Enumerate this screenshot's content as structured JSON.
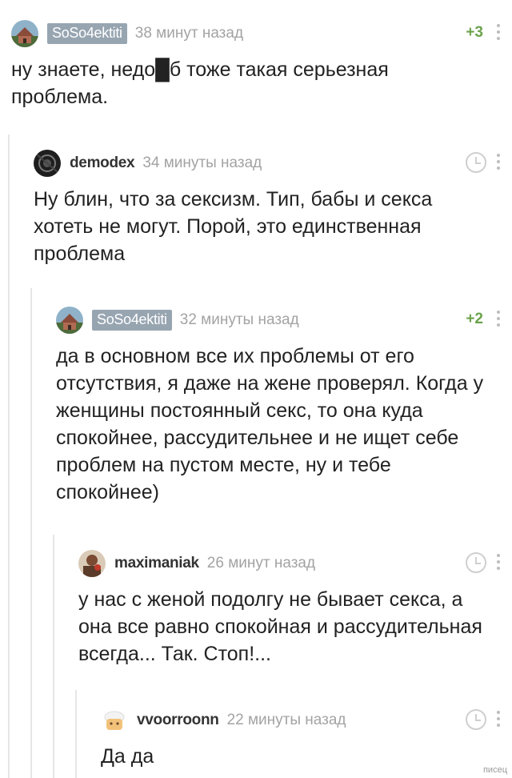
{
  "comments": [
    {
      "author": "SoSo4ektiti",
      "time": "38 минут назад",
      "rating": "+3",
      "text": "ну знаете, недо█б тоже такая серьезная проблема."
    },
    {
      "author": "demodex",
      "time": "34 минуты назад",
      "text": "Ну блин, что за сексизм. Тип, бабы и секса хотеть не могут. Порой, это единственная проблема"
    },
    {
      "author": "SoSo4ektiti",
      "time": "32 минуты назад",
      "rating": "+2",
      "text": "да в основном все их проблемы от его отсутствия, я даже на жене проверял. Когда у женщины постоянный секс, то она куда спокойнее, рассудительнее и не ищет себе проблем на пустом месте, ну и тебе спокойнее)"
    },
    {
      "author": "maximaniak",
      "time": "26 минут назад",
      "text": "у нас с женой подолгу не бывает секса, а она все равно спокойная и рассудительная всегда... Так. Стоп!..."
    },
    {
      "author": "vvoorroonn",
      "time": "22 минуты назад",
      "text": "Да да"
    }
  ],
  "watermark": "писец",
  "icons": {
    "clock": "clock-icon",
    "more": "more-vertical-icon"
  },
  "colors": {
    "rating": "#6ca34d",
    "badge": "#97a5b1",
    "muted": "#a3a3a3"
  }
}
